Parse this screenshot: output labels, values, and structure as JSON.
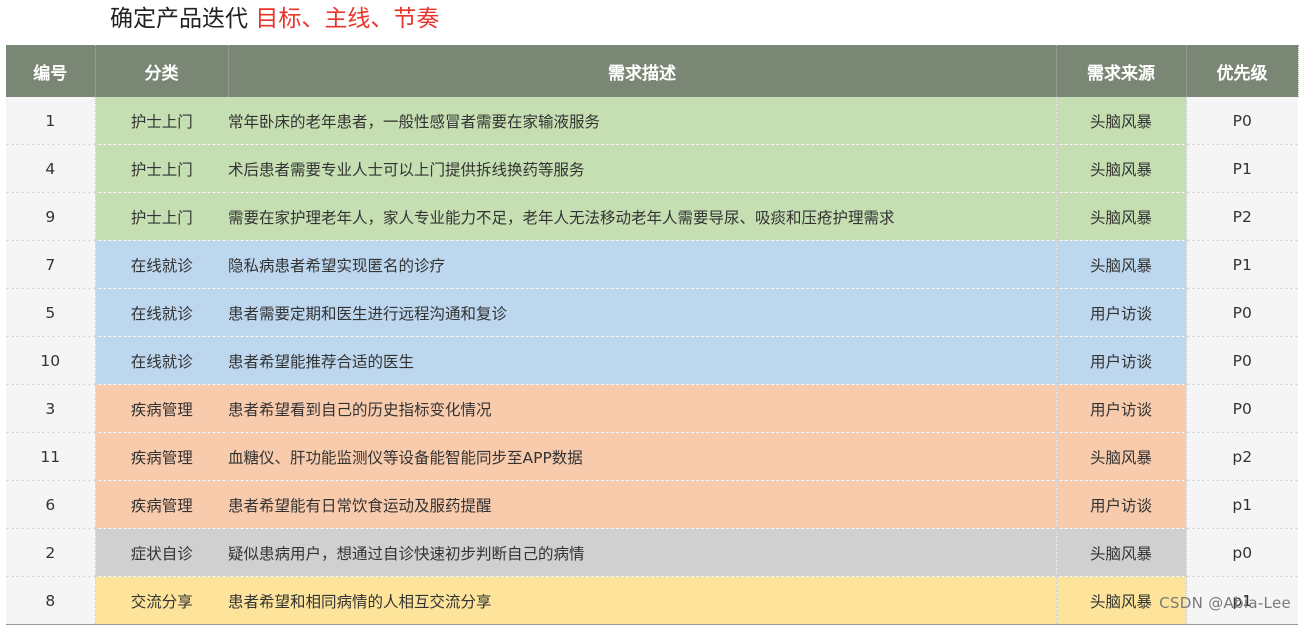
{
  "title": {
    "prefix": "确定产品迭代",
    "highlight": "目标、主线、节奏"
  },
  "table": {
    "headers": {
      "num": "编号",
      "category": "分类",
      "description": "需求描述",
      "source": "需求来源",
      "priority": "优先级"
    },
    "rows": [
      {
        "num": "1",
        "category": "护士上门",
        "description": "常年卧床的老年患者，一般性感冒者需要在家输液服务",
        "source": "头脑风暴",
        "priority": "P0"
      },
      {
        "num": "4",
        "category": "护士上门",
        "description": "术后患者需要专业人士可以上门提供拆线换药等服务",
        "source": "头脑风暴",
        "priority": "P1"
      },
      {
        "num": "9",
        "category": "护士上门",
        "description": "需要在家护理老年人，家人专业能力不足，老年人无法移动老年人需要导尿、吸痰和压疮护理需求",
        "source": "头脑风暴",
        "priority": "P2"
      },
      {
        "num": "7",
        "category": "在线就诊",
        "description": "隐私病患者希望实现匿名的诊疗",
        "source": "头脑风暴",
        "priority": "P1"
      },
      {
        "num": "5",
        "category": "在线就诊",
        "description": "患者需要定期和医生进行远程沟通和复诊",
        "source": "用户访谈",
        "priority": "P0"
      },
      {
        "num": "10",
        "category": "在线就诊",
        "description": "患者希望能推荐合适的医生",
        "source": "用户访谈",
        "priority": "P0"
      },
      {
        "num": "3",
        "category": "疾病管理",
        "description": "患者希望看到自己的历史指标变化情况",
        "source": "用户访谈",
        "priority": "P0"
      },
      {
        "num": "11",
        "category": "疾病管理",
        "description": "血糖仪、肝功能监测仪等设备能智能同步至APP数据",
        "source": "头脑风暴",
        "priority": "p2"
      },
      {
        "num": "6",
        "category": "疾病管理",
        "description": "患者希望能有日常饮食运动及服药提醒",
        "source": "用户访谈",
        "priority": "p1"
      },
      {
        "num": "2",
        "category": "症状自诊",
        "description": "疑似患病用户，想通过自诊快速初步判断自己的病情",
        "source": "头脑风暴",
        "priority": "p0"
      },
      {
        "num": "8",
        "category": "交流分享",
        "description": "患者希望和相同病情的人相互交流分享",
        "source": "头脑风暴",
        "priority": "p1"
      }
    ]
  },
  "colors": {
    "header": "#7b8775",
    "nurse_visit": "#c5dfb3",
    "online_consult": "#bcd7ee",
    "disease_mgmt": "#f8cbad",
    "self_diagnosis": "#d0d0d0",
    "sharing": "#fde49a",
    "title_accent": "#e8352b"
  },
  "watermark": "CSDN @Abia-Lee"
}
